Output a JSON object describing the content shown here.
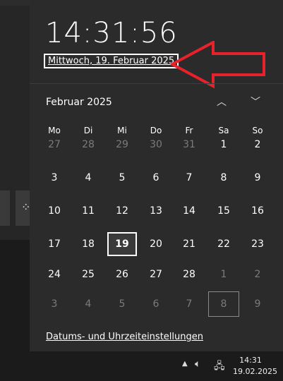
{
  "clock": {
    "time": "14:31:56",
    "long_date": "Mittwoch, 19. Februar 2025"
  },
  "calendar": {
    "month_label": "Februar 2025",
    "weekdays": [
      "Mo",
      "Di",
      "Mi",
      "Do",
      "Fr",
      "Sa",
      "So"
    ],
    "rows": [
      [
        "27",
        "28",
        "29",
        "30",
        "31",
        "1",
        "2"
      ],
      [
        "3",
        "4",
        "5",
        "6",
        "7",
        "8",
        "9"
      ],
      [
        "10",
        "11",
        "12",
        "13",
        "14",
        "15",
        "16"
      ],
      [
        "17",
        "18",
        "19",
        "20",
        "21",
        "22",
        "23"
      ],
      [
        "24",
        "25",
        "26",
        "27",
        "28",
        "1",
        "2"
      ],
      [
        "3",
        "4",
        "5",
        "6",
        "7",
        "8",
        "9"
      ]
    ],
    "muted_cells": [
      [
        0,
        0
      ],
      [
        0,
        1
      ],
      [
        0,
        2
      ],
      [
        0,
        3
      ],
      [
        0,
        4
      ],
      [
        4,
        5
      ],
      [
        4,
        6
      ],
      [
        5,
        0
      ],
      [
        5,
        1
      ],
      [
        5,
        2
      ],
      [
        5,
        3
      ],
      [
        5,
        4
      ],
      [
        5,
        5
      ],
      [
        5,
        6
      ]
    ],
    "today_cell": [
      3,
      2
    ],
    "selected_cell": [
      5,
      5
    ],
    "icons": {
      "prev": "chevron-up-icon",
      "next": "chevron-down-icon"
    }
  },
  "footer": {
    "settings_link": "Datums- und Uhrzeiteinstellungen"
  },
  "taskbar": {
    "time": "14:31",
    "date": "19.02.2025",
    "icons": [
      "show-hidden-icons-icon",
      "volume-icon",
      "network-icon"
    ]
  },
  "annotation": {
    "color": "#e8222a"
  }
}
